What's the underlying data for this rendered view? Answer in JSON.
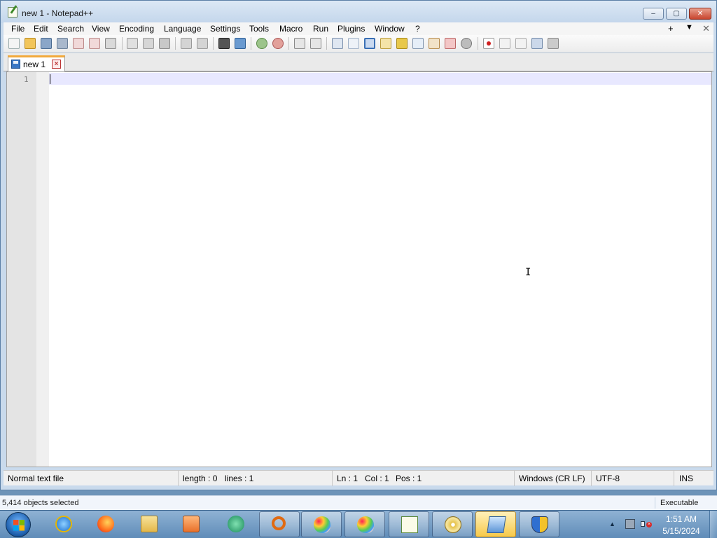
{
  "window": {
    "title": "new 1 - Notepad++",
    "controls": {
      "minimize": "‒",
      "maximize": "▢",
      "close": "✕"
    }
  },
  "menu": {
    "items": [
      "File",
      "Edit",
      "Search",
      "View",
      "Encoding",
      "Language",
      "Settings",
      "Tools",
      "Macro",
      "Run",
      "Plugins",
      "Window",
      "?"
    ],
    "right": {
      "plus": "+",
      "dropdown": "▼",
      "close": "✕"
    }
  },
  "toolbar": {
    "icons": [
      "new-file-icon",
      "open-file-icon",
      "save-icon",
      "save-all-icon",
      "close-icon",
      "close-all-icon",
      "print-icon",
      "cut-icon",
      "copy-icon",
      "paste-icon",
      "undo-icon",
      "redo-icon",
      "find-icon",
      "replace-icon",
      "zoom-in-icon",
      "zoom-out-icon",
      "sync-vertical-icon",
      "sync-horizontal-icon",
      "word-wrap-icon",
      "show-all-characters-icon",
      "indent-guide-icon",
      "user-language-icon",
      "document-map-icon",
      "function-list-icon",
      "folder-as-workspace-icon",
      "monitoring-icon",
      "record-macro-icon",
      "stop-recording-icon",
      "playback-macro-icon",
      "run-macro-multiple-icon",
      "save-macro-icon"
    ]
  },
  "tabs": [
    {
      "label": "new 1",
      "icon": "save-icon",
      "close_icon": "close-tab-icon"
    }
  ],
  "editor": {
    "line_numbers": [
      "1"
    ],
    "content": ""
  },
  "status": {
    "file_type": "Normal text file",
    "length": "length : 0",
    "lines": "lines : 1",
    "ln": "Ln : 1",
    "col": "Col : 1",
    "pos": "Pos : 1",
    "eol": "Windows (CR LF)",
    "encoding": "UTF-8",
    "mode": "INS"
  },
  "explorer": {
    "status": "5,414 objects selected",
    "type": "Executable"
  },
  "taskbar": {
    "apps": [
      "internet-explorer-icon",
      "firefox-icon",
      "file-explorer-icon",
      "media-player-icon",
      "media-center-icon",
      "search-tool-icon",
      "paint-icon",
      "paint-icon",
      "notepad-plus-plus-icon",
      "disc-icon",
      "display-settings-icon",
      "security-shield-icon"
    ],
    "tray_arrow": "▲",
    "time": "1:51 AM",
    "date": "5/15/2024"
  },
  "colors": {
    "current_line": "#e8e8ff",
    "tab_accent": "#f2a93b",
    "taskbar": "#5f8cb8"
  }
}
